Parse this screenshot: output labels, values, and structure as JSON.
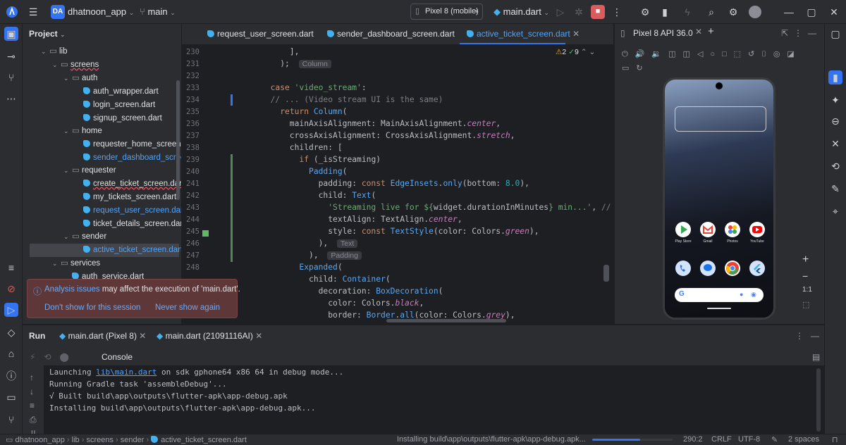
{
  "titlebar": {
    "project_initials": "DA",
    "project_name": "dhatnoon_app",
    "branch": "main",
    "device": "Pixel 8 (mobile)",
    "run_config": "main.dart"
  },
  "project_panel": {
    "title": "Project",
    "rows": [
      {
        "label": "lib",
        "type": "folder"
      },
      {
        "label": "screens",
        "type": "folder"
      },
      {
        "label": "auth",
        "type": "folder"
      },
      {
        "label": "auth_wrapper.dart",
        "type": "file"
      },
      {
        "label": "login_screen.dart",
        "type": "file"
      },
      {
        "label": "signup_screen.dart",
        "type": "file"
      },
      {
        "label": "home",
        "type": "folder"
      },
      {
        "label": "requester_home_screen.dart",
        "type": "file"
      },
      {
        "label": "sender_dashboard_screen.dart",
        "type": "file"
      },
      {
        "label": "requester",
        "type": "folder"
      },
      {
        "label": "create_ticket_screen.dart",
        "type": "file"
      },
      {
        "label": "my_tickets_screen.dart",
        "type": "file"
      },
      {
        "label": "request_user_screen.dart",
        "type": "file"
      },
      {
        "label": "ticket_details_screen.dart",
        "type": "file"
      },
      {
        "label": "sender",
        "type": "folder"
      },
      {
        "label": "active_ticket_screen.dart",
        "type": "file"
      },
      {
        "label": "services",
        "type": "folder"
      },
      {
        "label": "auth_service.dart",
        "type": "file"
      }
    ]
  },
  "editor": {
    "tabs": [
      "request_user_screen.dart",
      "sender_dashboard_screen.dart",
      "active_ticket_screen.dart"
    ],
    "inspections": {
      "warnings": "2",
      "ok": "9"
    },
    "line_numbers": [
      "230",
      "231",
      "232",
      "233",
      "234",
      "235",
      "236",
      "237",
      "238",
      "239",
      "240",
      "241",
      "242",
      "243",
      "244",
      "245",
      "246",
      "247",
      "248"
    ],
    "hints": {
      "column_1": "Column",
      "text": "Text",
      "padding": "Padding"
    }
  },
  "emulator": {
    "title": "Pixel 8 API 36.0",
    "apps_row1": [
      "Play Store",
      "Gmail",
      "Photos",
      "YouTube"
    ],
    "widget_text": "Search Google",
    "zoom_label": "1:1"
  },
  "popup": {
    "link": "Analysis issues",
    "message": " may affect the execution of 'main.dart'.",
    "action1": "Don't show for this session",
    "action2": "Never show again"
  },
  "run_panel": {
    "title": "Run",
    "tabs": [
      "main.dart (Pixel 8)",
      "main.dart (21091116AI)"
    ],
    "console_label": "Console",
    "lines": [
      {
        "pre": "Launching ",
        "link": "lib\\main.dart",
        "post": " on sdk gphone64 x86 64 in debug mode..."
      },
      {
        "pre": "Running Gradle task 'assembleDebug'...",
        "link": "",
        "post": ""
      },
      {
        "pre": "√ Built build\\app\\outputs\\flutter-apk\\app-debug.apk",
        "link": "",
        "post": ""
      },
      {
        "pre": "Installing build\\app\\outputs\\flutter-apk\\app-debug.apk...",
        "link": "",
        "post": ""
      }
    ]
  },
  "status": {
    "crumbs": [
      "dhatnoon_app",
      "lib",
      "screens",
      "sender",
      "active_ticket_screen.dart"
    ],
    "task": "Installing build\\app\\outputs\\flutter-apk\\app-debug.apk...",
    "progress": 0.6,
    "position": "290:2",
    "line_sep": "CRLF",
    "encoding": "UTF-8",
    "indent": "2 spaces"
  },
  "colors": {
    "accent": "#3574f0",
    "link": "#54a3f7",
    "popup_bg": "#5e3838",
    "stop": "#db5c5c"
  }
}
